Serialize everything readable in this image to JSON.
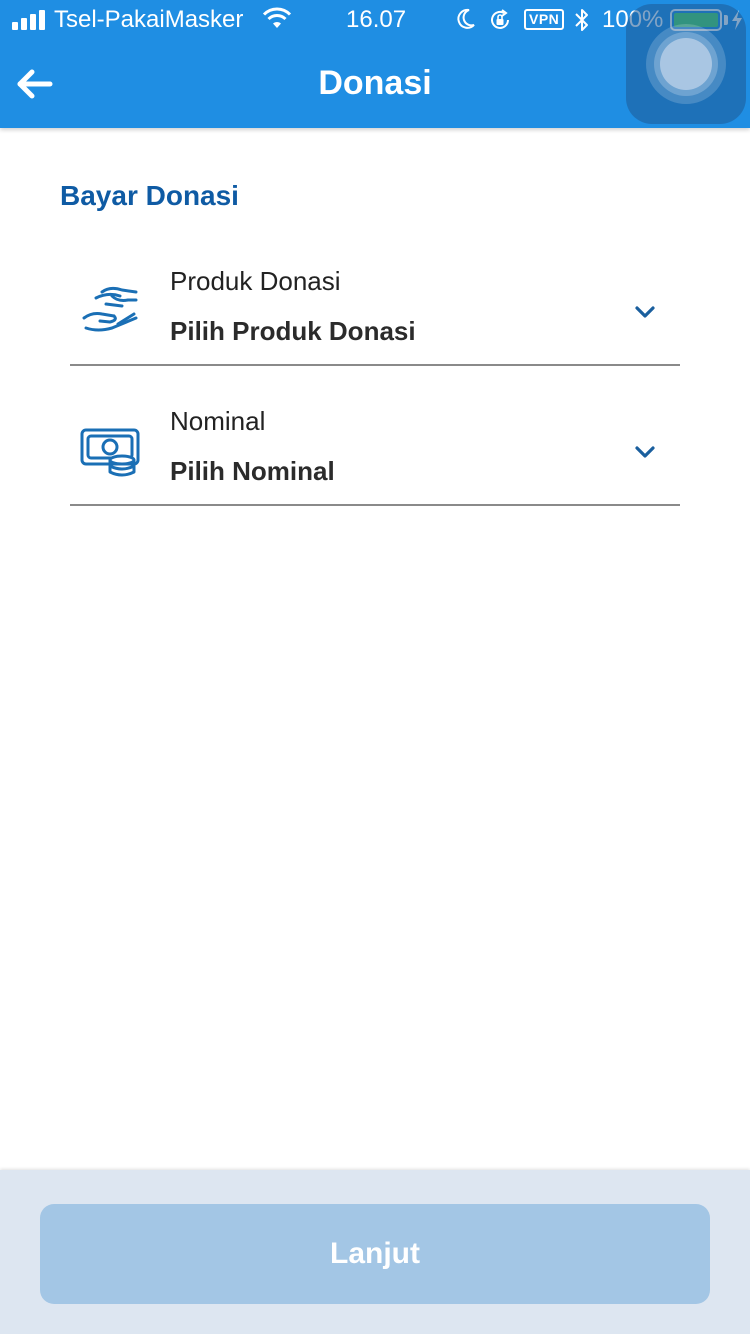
{
  "status_bar": {
    "carrier": "Tsel-PakaiMasker",
    "time": "16.07",
    "vpn_label": "VPN",
    "battery_percent": "100%",
    "battery_level": 1.0,
    "icons": [
      "signal-bars-icon",
      "wifi-icon",
      "moon-icon",
      "rotation-lock-icon",
      "vpn-badge",
      "bluetooth-icon",
      "battery-icon",
      "charging-bolt-icon"
    ]
  },
  "nav": {
    "title": "Donasi",
    "back_icon": "arrow-left-icon"
  },
  "form": {
    "section_title": "Bayar Donasi",
    "fields": [
      {
        "label": "Produk Donasi",
        "value": "Pilih Produk Donasi",
        "icon": "donation-hand-icon"
      },
      {
        "label": "Nominal",
        "value": "Pilih Nominal",
        "icon": "money-coins-icon"
      }
    ]
  },
  "footer": {
    "button_label": "Lanjut"
  },
  "colors": {
    "primary": "#1f8ee3",
    "heading": "#0f5ba4",
    "button_disabled": "#a3c6e5",
    "footer_bg": "#dde6f1"
  }
}
